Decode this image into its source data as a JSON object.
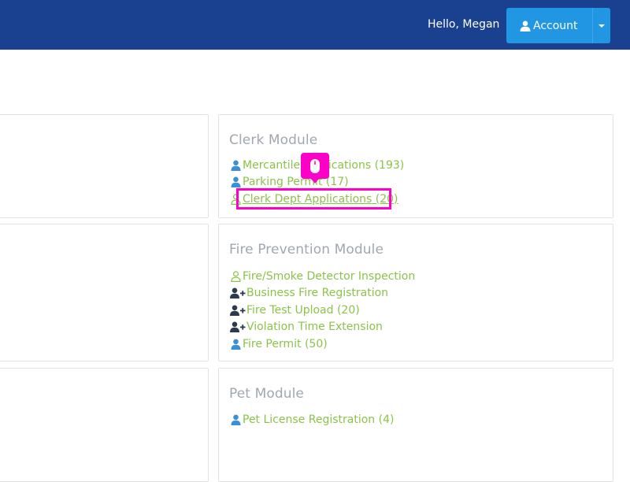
{
  "header": {
    "greeting": "Hello, Megan",
    "account_label": "Account"
  },
  "clerk": {
    "title": "Clerk Module",
    "links": [
      {
        "label": "Mercantile Applications (193)",
        "icon": "user-icon"
      },
      {
        "label": "Parking Permit (17)",
        "icon": "user-icon"
      },
      {
        "label": "Clerk Dept Applications (20)",
        "icon": "user-outline-icon"
      }
    ]
  },
  "fire": {
    "title": "Fire Prevention Module",
    "links": [
      {
        "label": "Fire/Smoke Detector Inspection",
        "icon": "user-outline-icon"
      },
      {
        "label": "Business Fire Registration",
        "icon": "user-plus-icon"
      },
      {
        "label": "Fire Test Upload (20)",
        "icon": "user-plus-icon"
      },
      {
        "label": "Violation Time Extension",
        "icon": "user-plus-icon"
      },
      {
        "label": "Fire Permit (50)",
        "icon": "user-icon"
      }
    ]
  },
  "pet": {
    "title": "Pet Module",
    "links": [
      {
        "label": "Pet License Registration (4)",
        "icon": "user-icon"
      }
    ]
  },
  "colors": {
    "navbar": "#1a4190",
    "account_button": "#2196e3",
    "link": "#8bc34a",
    "highlight": "#ff00c8"
  }
}
